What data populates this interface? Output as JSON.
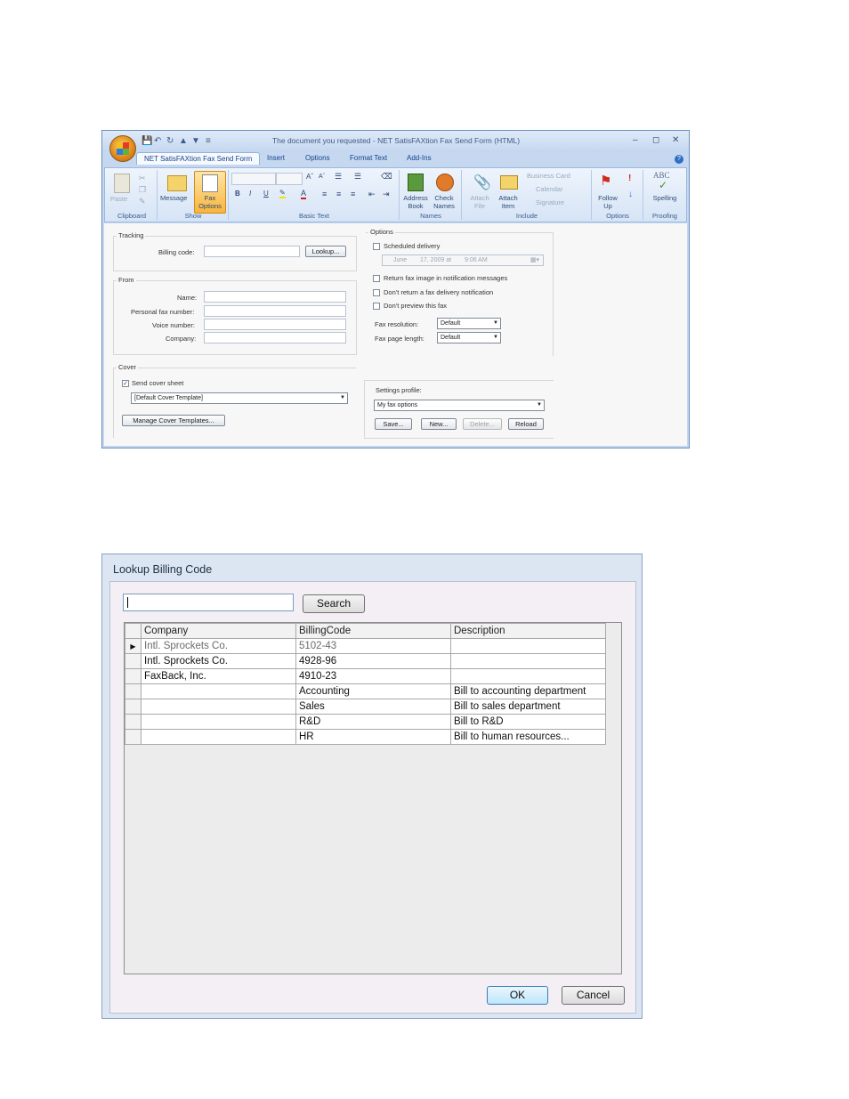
{
  "outlook": {
    "window_title": "The document you requested - NET SatisFAXtion Fax Send Form (HTML)",
    "tabs": [
      "NET SatisFAXtion Fax Send Form",
      "Insert",
      "Options",
      "Format Text",
      "Add-Ins"
    ],
    "ribbon": {
      "clipboard": {
        "label": "Clipboard",
        "paste": "Paste"
      },
      "show": {
        "label": "Show",
        "message": "Message",
        "fax_options": "Fax Options"
      },
      "basic_text": {
        "label": "Basic Text",
        "bold": "B",
        "italic": "I",
        "underline": "U"
      },
      "names": {
        "label": "Names",
        "address_book": "Address Book",
        "check_names": "Check Names"
      },
      "include": {
        "label": "Include",
        "attach_file": "Attach File",
        "attach_item": "Attach Item",
        "business_card": "Business Card",
        "calendar": "Calendar",
        "signature": "Signature"
      },
      "options": {
        "label": "Options",
        "follow_up": "Follow Up"
      },
      "proofing": {
        "label": "Proofing",
        "spelling": "Spelling",
        "abc": "ABC"
      }
    },
    "tracking": {
      "title": "Tracking",
      "billing_code_label": "Billing code:",
      "lookup_button": "Lookup..."
    },
    "from": {
      "title": "From",
      "name_label": "Name:",
      "personal_fax_label": "Personal fax number:",
      "voice_label": "Voice number:",
      "company_label": "Company:"
    },
    "cover": {
      "title": "Cover",
      "send_cover_label": "Send cover sheet",
      "send_cover_checked": true,
      "template_value": "[Default Cover Template]",
      "manage_button": "Manage Cover Templates..."
    },
    "options": {
      "title": "Options",
      "scheduled_label": "Scheduled delivery",
      "date_month": "June",
      "date_rest": "17, 2009 at",
      "time": "9:06 AM",
      "return_image_label": "Return fax image in notification messages",
      "dont_return_label": "Don't return a fax delivery notification",
      "dont_preview_label": "Don't preview this fax",
      "resolution_label": "Fax resolution:",
      "resolution_value": "Default",
      "page_length_label": "Fax page length:",
      "page_length_value": "Default"
    },
    "settings": {
      "label": "Settings profile:",
      "value": "My fax options",
      "save": "Save...",
      "new": "New...",
      "delete": "Delete...",
      "reload": "Reload"
    }
  },
  "dialog": {
    "title": "Lookup Billing Code",
    "search_value": "",
    "search_button": "Search",
    "columns": [
      "Company",
      "BillingCode",
      "Description"
    ],
    "rows": [
      {
        "company": "Intl. Sprockets Co.",
        "code": "5102-43",
        "description": ""
      },
      {
        "company": "Intl. Sprockets Co.",
        "code": "4928-96",
        "description": ""
      },
      {
        "company": "FaxBack, Inc.",
        "code": "4910-23",
        "description": ""
      },
      {
        "company": "",
        "code": "Accounting",
        "description": "Bill to accounting department"
      },
      {
        "company": "",
        "code": "Sales",
        "description": "Bill to sales department"
      },
      {
        "company": "",
        "code": "R&D",
        "description": "Bill to R&D"
      },
      {
        "company": "",
        "code": "HR",
        "description": "Bill to human resources..."
      }
    ],
    "ok_button": "OK",
    "cancel_button": "Cancel"
  }
}
